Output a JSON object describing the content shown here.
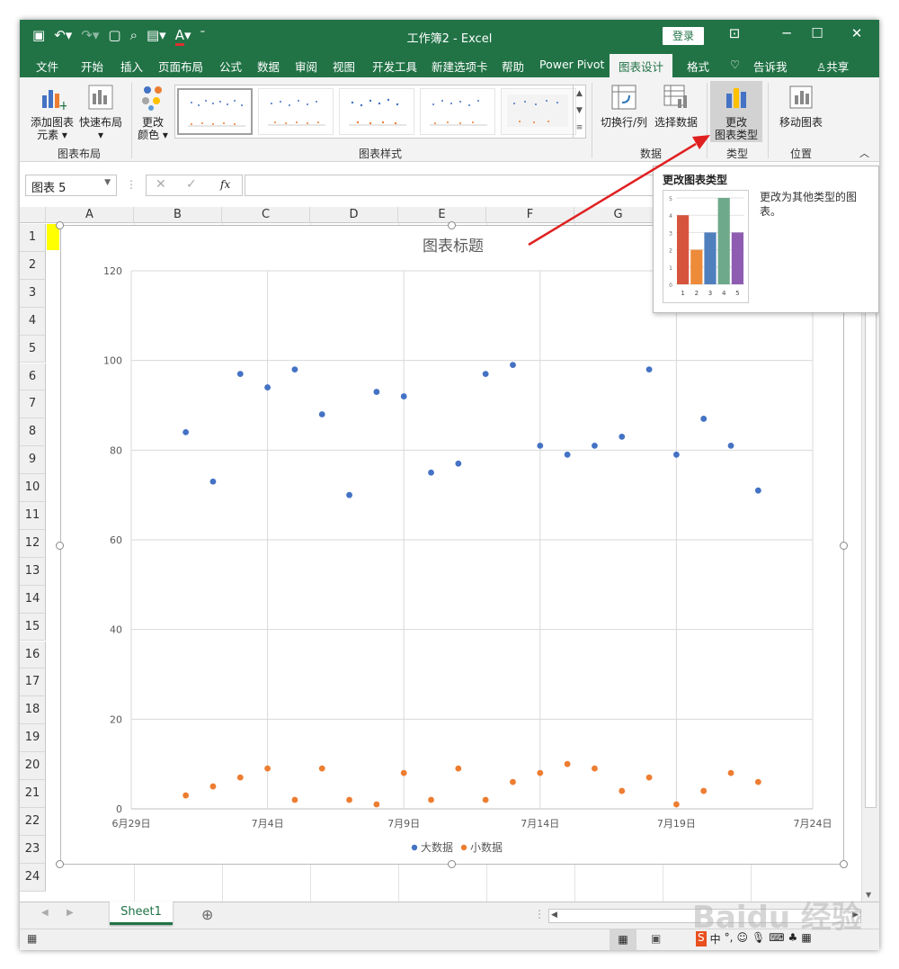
{
  "titlebar": {
    "title": "工作簿2 - Excel",
    "login_label": "登录",
    "qat_icons": [
      "save-icon",
      "undo-icon",
      "redo-icon",
      "new-icon",
      "print-preview-icon",
      "paste-icon",
      "font-color-icon",
      "customize-icon"
    ],
    "font_color_letter": "A"
  },
  "tabs": {
    "file": "文件",
    "home": "开始",
    "insert": "插入",
    "page_layout": "页面布局",
    "formulas": "公式",
    "data": "数据",
    "review": "审阅",
    "view": "视图",
    "developer": "开发工具",
    "new_tab": "新建选项卡",
    "help": "帮助",
    "power_pivot": "Power Pivot",
    "chart_design": "图表设计",
    "format": "格式",
    "tell_me": "告诉我",
    "share": "共享"
  },
  "ribbon": {
    "add_element": "添加图表元素",
    "add_element_l1": "添加图表",
    "add_element_l2": "元素",
    "quick_layout": "快速布局",
    "change_colors_l1": "更改",
    "change_colors_l2": "颜色",
    "group_layout": "图表布局",
    "group_styles": "图表样式",
    "switch_row_col": "切换行/列",
    "select_data": "选择数据",
    "group_data": "数据",
    "change_type_l1": "更改",
    "change_type_l2": "图表类型",
    "group_type": "类型",
    "move_chart": "移动图表",
    "group_location": "位置",
    "accent": "#217346"
  },
  "formula": {
    "name_box": "图表 5",
    "fx": "fx"
  },
  "columns": [
    "A",
    "B",
    "C",
    "D",
    "E",
    "F",
    "G"
  ],
  "rows": [
    "1",
    "2",
    "3",
    "4",
    "5",
    "6",
    "7",
    "8",
    "9",
    "10",
    "11",
    "12",
    "13",
    "14",
    "15",
    "16",
    "17",
    "18",
    "19",
    "20",
    "21",
    "22",
    "23",
    "24"
  ],
  "tooltip": {
    "title": "更改图表类型",
    "description": "更改为其他类型的图表。",
    "preview_values": [
      4,
      2,
      3,
      5,
      3
    ],
    "preview_categories": [
      "1",
      "2",
      "3",
      "4",
      "5"
    ],
    "preview_colors": [
      "#d6543c",
      "#ed8b3a",
      "#4f7fbd",
      "#6fa98b",
      "#8e5db1"
    ]
  },
  "chart_data": {
    "type": "scatter",
    "title": "图表标题",
    "xlabel": "",
    "ylabel": "",
    "ylim": [
      0,
      120
    ],
    "yticks": [
      0,
      20,
      40,
      60,
      80,
      100,
      120
    ],
    "xlim": [
      "2019-06-29",
      "2019-07-24"
    ],
    "xticks": [
      "6月29日",
      "7月4日",
      "7月9日",
      "7月14日",
      "7月19日",
      "7月24日"
    ],
    "x_dates": [
      "2019-07-01",
      "2019-07-02",
      "2019-07-03",
      "2019-07-04",
      "2019-07-05",
      "2019-07-06",
      "2019-07-07",
      "2019-07-08",
      "2019-07-09",
      "2019-07-10",
      "2019-07-11",
      "2019-07-12",
      "2019-07-13",
      "2019-07-14",
      "2019-07-15",
      "2019-07-16",
      "2019-07-17",
      "2019-07-18",
      "2019-07-19",
      "2019-07-20",
      "2019-07-21",
      "2019-07-22"
    ],
    "series": [
      {
        "name": "大数据",
        "color": "#4472c4",
        "values": [
          84,
          73,
          97,
          94,
          98,
          88,
          70,
          93,
          92,
          75,
          77,
          97,
          99,
          81,
          79,
          81,
          83,
          98,
          79,
          87,
          81,
          71
        ]
      },
      {
        "name": "小数据",
        "color": "#ed7d31",
        "values": [
          3,
          5,
          7,
          9,
          2,
          9,
          2,
          1,
          8,
          2,
          9,
          2,
          6,
          8,
          10,
          9,
          4,
          7,
          1,
          4,
          8,
          6
        ]
      }
    ],
    "grid": true,
    "legend": "bottom"
  },
  "sheet_tab": "Sheet1",
  "add_sheet": "⊕",
  "watermark": "Baidu 经验"
}
